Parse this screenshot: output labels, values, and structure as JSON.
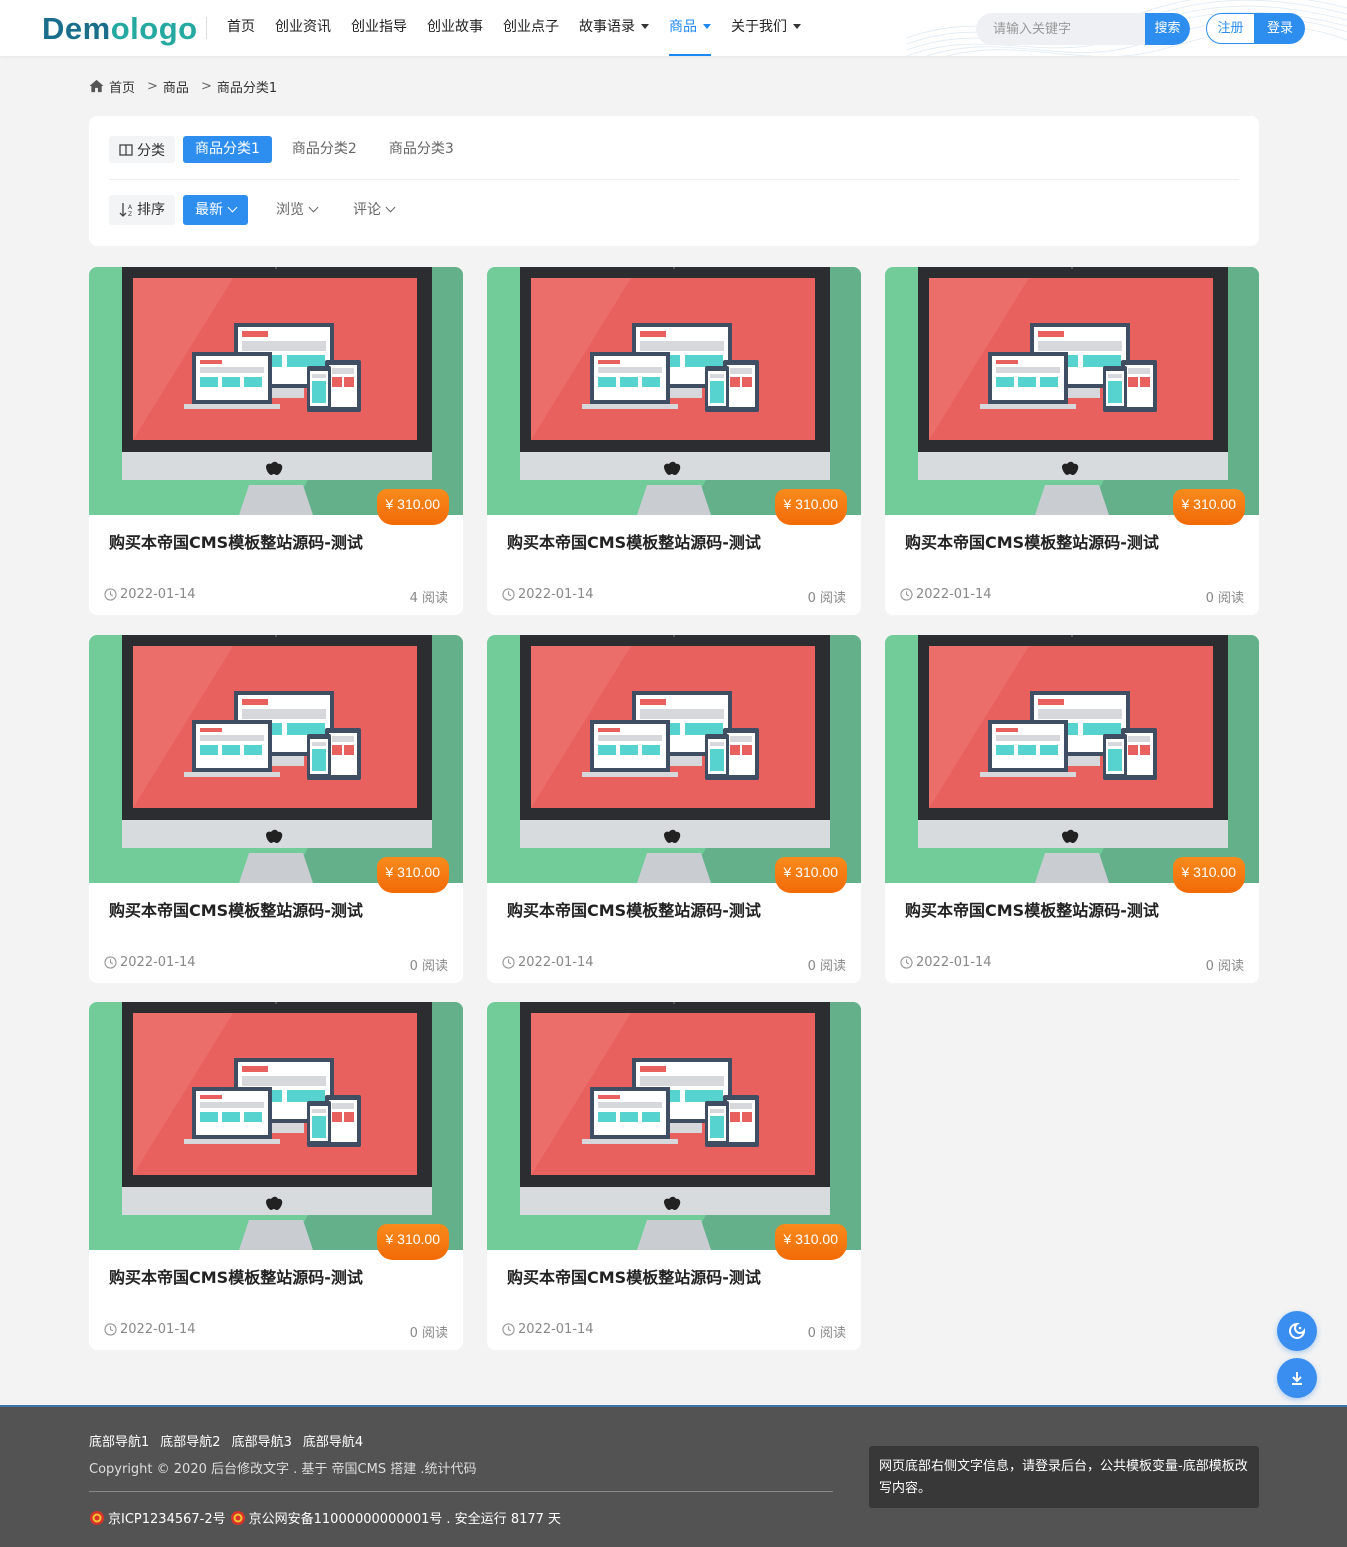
{
  "header": {
    "logo_part1": "Dem",
    "logo_part2": "ologo",
    "nav": [
      {
        "label": "首页"
      },
      {
        "label": "创业资讯"
      },
      {
        "label": "创业指导"
      },
      {
        "label": "创业故事"
      },
      {
        "label": "创业点子"
      },
      {
        "label": "故事语录"
      },
      {
        "label": "商品"
      },
      {
        "label": "关于我们"
      }
    ],
    "search_placeholder": "请输入关键字",
    "search_button": "搜索",
    "register": "注册",
    "login": "登录",
    "accent_color": "#2d8ef0"
  },
  "breadcrumb": {
    "home": "首页",
    "sep1": ">",
    "level1": "商品",
    "sep2": ">",
    "level2": "商品分类1"
  },
  "filter": {
    "category_label": "分类",
    "categories": [
      "商品分类1",
      "商品分类2",
      "商品分类3"
    ],
    "sort_label": "排序",
    "sorts": [
      "最新",
      "浏览",
      "评论"
    ]
  },
  "products": [
    {
      "title": "购买本帝国CMS模板整站源码-测试",
      "price": "¥ 310.00",
      "date": "2022-01-14",
      "views": "4 阅读"
    },
    {
      "title": "购买本帝国CMS模板整站源码-测试",
      "price": "¥ 310.00",
      "date": "2022-01-14",
      "views": "0 阅读"
    },
    {
      "title": "购买本帝国CMS模板整站源码-测试",
      "price": "¥ 310.00",
      "date": "2022-01-14",
      "views": "0 阅读"
    },
    {
      "title": "购买本帝国CMS模板整站源码-测试",
      "price": "¥ 310.00",
      "date": "2022-01-14",
      "views": "0 阅读"
    },
    {
      "title": "购买本帝国CMS模板整站源码-测试",
      "price": "¥ 310.00",
      "date": "2022-01-14",
      "views": "0 阅读"
    },
    {
      "title": "购买本帝国CMS模板整站源码-测试",
      "price": "¥ 310.00",
      "date": "2022-01-14",
      "views": "0 阅读"
    },
    {
      "title": "购买本帝国CMS模板整站源码-测试",
      "price": "¥ 310.00",
      "date": "2022-01-14",
      "views": "0 阅读"
    },
    {
      "title": "购买本帝国CMS模板整站源码-测试",
      "price": "¥ 310.00",
      "date": "2022-01-14",
      "views": "0 阅读"
    }
  ],
  "floating": {
    "theme_icon": "moon-icon",
    "download_icon": "download-icon"
  },
  "footer": {
    "nav": [
      "底部导航1",
      "底部导航2",
      "底部导航3",
      "底部导航4"
    ],
    "copyright": "Copyright © 2020 后台修改文字 . 基于 帝国CMS 搭建 .统计代码",
    "icp": "京ICP1234567-2号",
    "police": "京公网安备11000000000001号",
    "uptime": ". 安全运行 8177 天",
    "right_text": "网页底部右侧文字信息，请登录后台，公共模板变量-底部模板改写内容。"
  }
}
